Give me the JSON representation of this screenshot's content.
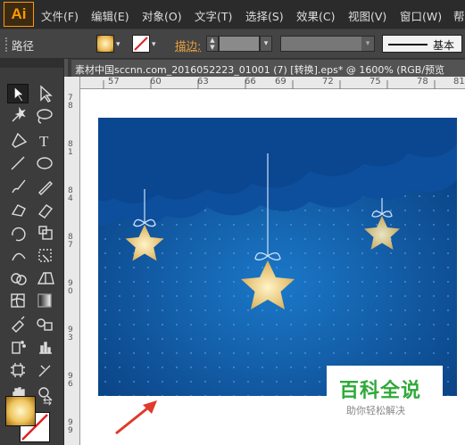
{
  "app": {
    "logo": "Ai",
    "menu": [
      "文件(F)",
      "编辑(E)",
      "对象(O)",
      "文字(T)",
      "选择(S)",
      "效果(C)",
      "视图(V)",
      "窗口(W)",
      "帮"
    ]
  },
  "control_bar": {
    "selection_label": "路径",
    "stroke_label": "描边:",
    "stroke_style": "基本"
  },
  "document": {
    "tab_title": "素材中国sccnn.com_2016052223_01001  (7)  [转换].eps* @ 1600% (RGB/预览"
  },
  "rulers": {
    "top": [
      "57",
      "60",
      "63",
      "66",
      "69",
      "72",
      "75",
      "78",
      "81"
    ],
    "left": [
      "78",
      "81",
      "84",
      "87",
      "90",
      "93",
      "96",
      "99"
    ]
  },
  "tools": [
    "selection-tool",
    "direct-selection-tool",
    "magic-wand-tool",
    "lasso-tool",
    "pen-tool",
    "type-tool",
    "line-tool",
    "ellipse-tool",
    "paintbrush-tool",
    "pencil-tool",
    "blob-brush-tool",
    "eraser-tool",
    "rotate-tool",
    "scale-tool",
    "width-tool",
    "free-transform-tool",
    "shape-builder-tool",
    "perspective-grid-tool",
    "mesh-tool",
    "gradient-tool",
    "eyedropper-tool",
    "blend-tool",
    "symbol-sprayer-tool",
    "column-graph-tool",
    "artboard-tool",
    "slice-tool",
    "hand-tool",
    "zoom-tool"
  ],
  "watermark": {
    "title": "百科全说",
    "subtitle": "助你轻松解决"
  },
  "colors": {
    "accent": "#ff9a00",
    "sky_dark": "#083a7a",
    "sky_light": "#1b78c8",
    "star": "#f3d27a",
    "arrow": "#e03a2a",
    "watermark_green": "#2faa3a"
  }
}
